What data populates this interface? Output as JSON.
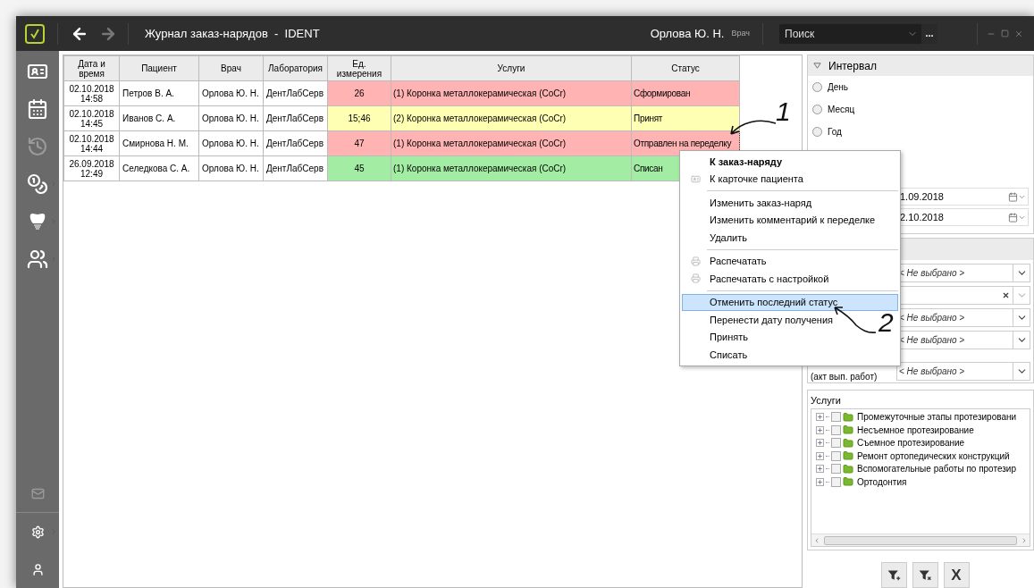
{
  "window": {
    "title": "Журнал заказ-нарядов  -  IDENT",
    "user": "Орлова Ю. Н.",
    "role": "Врач",
    "back_disabled": false,
    "forward_disabled": true
  },
  "search": {
    "placeholder": "Поиск",
    "more": "..."
  },
  "sidebar": {
    "items": [
      {
        "disabled": false,
        "submenu": false
      },
      {
        "disabled": false,
        "submenu": false
      },
      {
        "disabled": true,
        "submenu": false
      },
      {
        "disabled": false,
        "submenu": true
      },
      {
        "disabled": false,
        "submenu": true
      },
      {
        "disabled": false,
        "submenu": true
      }
    ],
    "bottom_items": [
      {
        "disabled": true,
        "submenu": false
      },
      {
        "disabled": false,
        "submenu": true
      },
      {
        "disabled": false,
        "submenu": false
      }
    ]
  },
  "table": {
    "columns": [
      "Дата и время",
      "Пациент",
      "Врач",
      "Лаборатория",
      "Ед. измерения",
      "Услуги",
      "Статус"
    ],
    "rows": [
      {
        "date": "02.10.2018",
        "time": "14:58",
        "patient": "Петров В. А.",
        "doctor": "Орлова Ю. Н.",
        "lab": "ДентЛабСерв",
        "units": "26",
        "service": "(1) Коронка металлокерамическая (CoCr)",
        "status": "Сформирован",
        "color": "#ffb3b3",
        "focused": false
      },
      {
        "date": "02.10.2018",
        "time": "14:45",
        "patient": "Иванов С. А.",
        "doctor": "Орлова Ю. Н.",
        "lab": "ДентЛабСерв",
        "units": "15;46",
        "service": "(2) Коронка металлокерамическая (CoCr)",
        "status": "Принят",
        "color": "#ffffb3",
        "focused": false
      },
      {
        "date": "02.10.2018",
        "time": "14:44",
        "patient": "Смирнова Н. М.",
        "doctor": "Орлова Ю. Н.",
        "lab": "ДентЛабСерв",
        "units": "47",
        "service": "(1) Коронка металлокерамическая (CoCr)",
        "status": "Отправлен на переделку",
        "color": "#ffb3b3",
        "focused": true
      },
      {
        "date": "26.09.2018",
        "time": "12:49",
        "patient": "Селедкова С. А.",
        "doctor": "Орлова Ю. Н.",
        "lab": "ДентЛабСерв",
        "units": "45",
        "service": "(1) Коронка металлокерамическая (CoCr)",
        "status": "Списан",
        "color": "#a3eca3",
        "focused": false
      }
    ]
  },
  "interval": {
    "title": "Интервал",
    "expanded": true,
    "options": [
      {
        "label": "День",
        "selected": false
      },
      {
        "label": "Месяц",
        "selected": false
      },
      {
        "label": "Год",
        "selected": false
      }
    ],
    "dates": [
      "1.09.2018",
      "2.10.2018"
    ]
  },
  "filters": [
    {
      "kind": "select",
      "value": "< Не выбрано >"
    },
    {
      "kind": "clearable"
    },
    {
      "kind": "select",
      "value": "< Не выбрано >"
    },
    {
      "kind": "select",
      "value": "< Не выбрано >"
    },
    {
      "kind": "select",
      "value": "< Не выбрано >",
      "label": "(акт вып. работ)"
    }
  ],
  "services": {
    "title": "Услуги",
    "items": [
      {
        "label": "Промежуточные этапы протезировани",
        "checked": false,
        "expanded": false
      },
      {
        "label": "Несъемное протезирование",
        "checked": false,
        "expanded": false
      },
      {
        "label": "Съемное протезирование",
        "checked": false,
        "expanded": false
      },
      {
        "label": "Ремонт ортопедических конструкций",
        "checked": false,
        "expanded": false
      },
      {
        "label": "Вспомогательные работы по протезир",
        "checked": false,
        "expanded": false
      },
      {
        "label": "Ортодонтия",
        "checked": false,
        "expanded": false
      }
    ]
  },
  "actions": [
    {
      "kind": "filter-add"
    },
    {
      "kind": "filter-clear"
    },
    {
      "kind": "text",
      "label": "X"
    }
  ],
  "context_menu": {
    "groups": [
      [
        {
          "label": "К заказ-наряду",
          "bold": true,
          "kind": "plain",
          "selected": false
        },
        {
          "label": "К карточке пациента",
          "bold": false,
          "kind": "card",
          "selected": false
        }
      ],
      [
        {
          "label": "Изменить заказ-наряд",
          "bold": false,
          "kind": "plain",
          "selected": false
        },
        {
          "label": "Изменить комментарий к переделке",
          "bold": false,
          "kind": "plain",
          "selected": false
        },
        {
          "label": "Удалить",
          "bold": false,
          "kind": "plain",
          "selected": false
        }
      ],
      [
        {
          "label": "Распечатать",
          "bold": false,
          "kind": "print",
          "selected": false
        },
        {
          "label": "Распечатать с настройкой",
          "bold": false,
          "kind": "print",
          "selected": false
        }
      ],
      [
        {
          "label": "Отменить последний статус",
          "bold": false,
          "kind": "plain",
          "selected": true
        },
        {
          "label": "Перенести дату получения",
          "bold": false,
          "kind": "plain",
          "selected": false
        },
        {
          "label": "Принять",
          "bold": false,
          "kind": "plain",
          "selected": false
        },
        {
          "label": "Списать",
          "bold": false,
          "kind": "plain",
          "selected": false
        }
      ]
    ]
  },
  "annotations": [
    {
      "label": "1"
    },
    {
      "label": "2"
    }
  ]
}
